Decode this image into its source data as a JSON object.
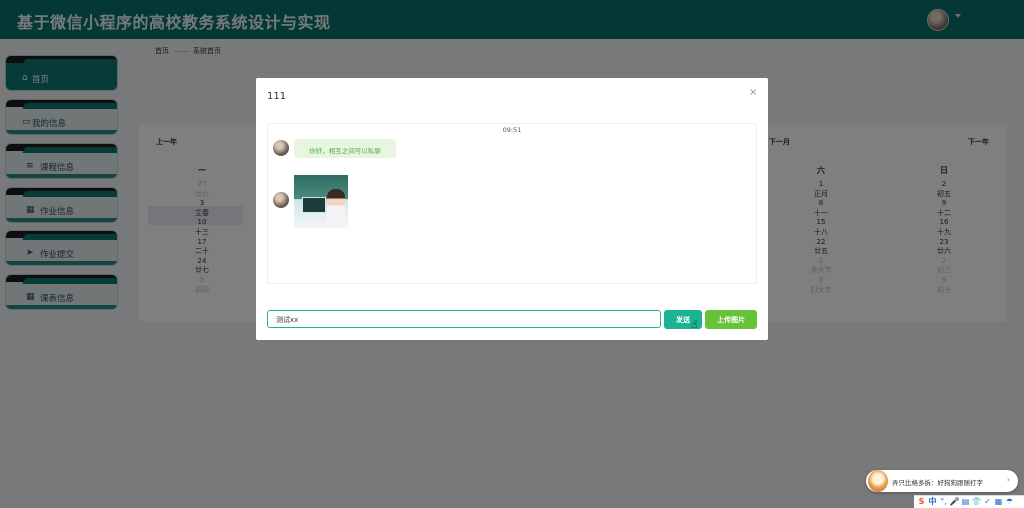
{
  "header": {
    "title": "基于微信小程序的高校教务系统设计与实现"
  },
  "sidebar": {
    "items": [
      {
        "icon": "home-icon",
        "glyph": "⌂",
        "label": "首页"
      },
      {
        "icon": "card-icon",
        "glyph": "▭",
        "label": "我的信息"
      },
      {
        "icon": "list-icon",
        "glyph": "≡",
        "label": "课程信息"
      },
      {
        "icon": "grid-icon",
        "glyph": "▦",
        "label": "作业信息"
      },
      {
        "icon": "send-icon",
        "glyph": "➤",
        "label": "作业提交"
      },
      {
        "icon": "grid-icon",
        "glyph": "▦",
        "label": "课表信息"
      }
    ]
  },
  "breadcrumb": {
    "home": "首页",
    "current": "系统首页"
  },
  "calendar": {
    "prev_year": "上一年",
    "next_month": "下一月",
    "next_year": "下一年",
    "weekdays": {
      "mon": "一",
      "sat": "六",
      "sun": "日"
    },
    "mon_col": [
      {
        "day": "27",
        "lunar": "廿六",
        "muted": true
      },
      {
        "day": "3",
        "lunar": "立春",
        "muted": false
      },
      {
        "day": "10",
        "lunar": "十三",
        "muted": false
      },
      {
        "day": "17",
        "lunar": "二十",
        "muted": false
      },
      {
        "day": "24",
        "lunar": "廿七",
        "muted": false
      },
      {
        "day": "3",
        "lunar": "初四",
        "muted": true
      }
    ],
    "sat_col": [
      {
        "day": "1",
        "lunar": "正月",
        "muted": false
      },
      {
        "day": "8",
        "lunar": "十一",
        "muted": false
      },
      {
        "day": "15",
        "lunar": "十八",
        "muted": false
      },
      {
        "day": "22",
        "lunar": "廿五",
        "muted": false
      },
      {
        "day": "1",
        "lunar": "龙头节",
        "muted": true
      },
      {
        "day": "8",
        "lunar": "妇女节",
        "muted": true
      }
    ],
    "sun_col": [
      {
        "day": "2",
        "lunar": "初五",
        "muted": false
      },
      {
        "day": "9",
        "lunar": "十二",
        "muted": false
      },
      {
        "day": "16",
        "lunar": "十九",
        "muted": false
      },
      {
        "day": "23",
        "lunar": "廿六",
        "muted": false
      },
      {
        "day": "2",
        "lunar": "初三",
        "muted": true
      },
      {
        "day": "9",
        "lunar": "初十",
        "muted": true
      }
    ]
  },
  "dialog": {
    "title": "111",
    "close_glyph": "×",
    "chat_time": "09:51",
    "message_text": "你好，相互之间可以私聊",
    "input_value": "测试xx",
    "send_label": "发送",
    "upload_label": "上传图片"
  },
  "ime": {
    "tip_text": "弄只比格多拆：好狗狗跟随打字",
    "arrow": "›",
    "bar": [
      "S",
      "中",
      "°,",
      "🎤",
      "▤",
      "👕",
      "✓",
      "▦",
      "☂"
    ]
  },
  "colors": {
    "header_bg": "#0b6f6a",
    "accent": "#1ab394",
    "upload": "#67c23a",
    "bubble_text": "#4caf50"
  }
}
